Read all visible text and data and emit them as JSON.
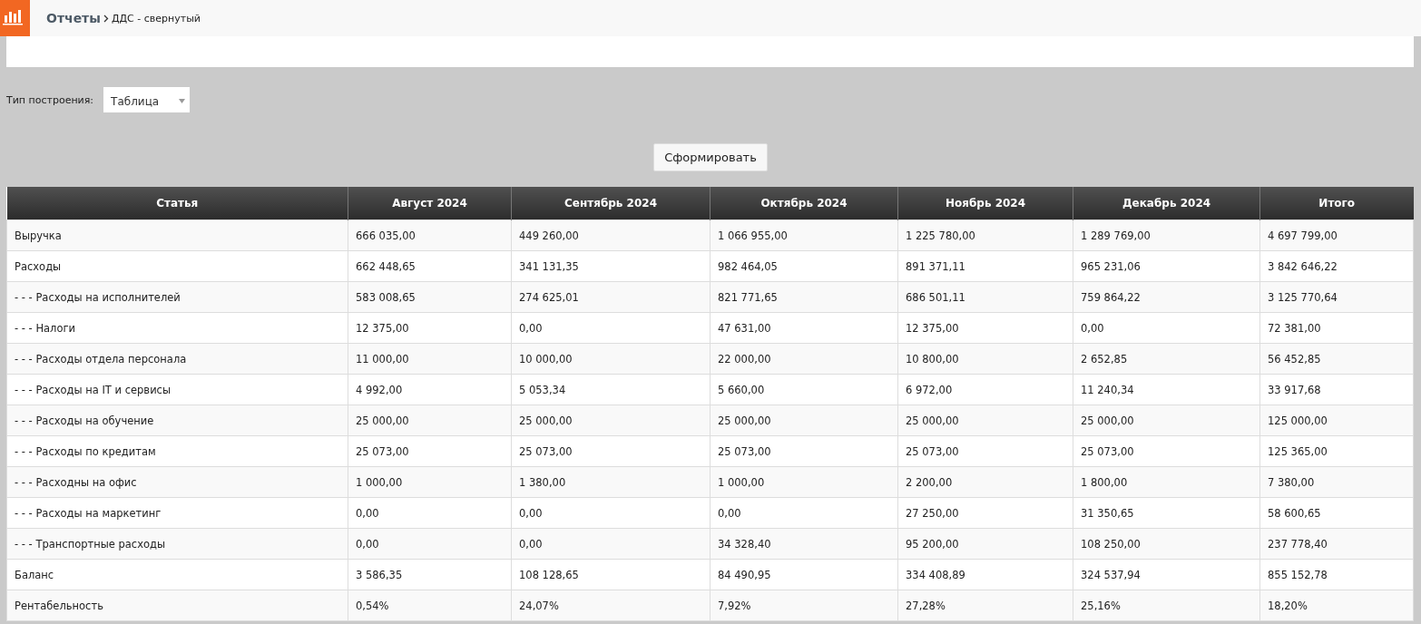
{
  "header": {
    "breadcrumb": [
      {
        "label": "Отчеты",
        "kind": "link"
      },
      {
        "label": "ДДС - свернутый",
        "kind": "current"
      }
    ]
  },
  "form": {
    "label": "Тип построения:",
    "select": {
      "value": "Таблица"
    },
    "button": "Сформировать"
  },
  "table": {
    "columns": [
      "Статья",
      "Август 2024",
      "Сентябрь 2024",
      "Октябрь 2024",
      "Ноябрь 2024",
      "Декабрь 2024",
      "Итого"
    ],
    "rows": [
      [
        "Выручка",
        "666 035,00",
        "449 260,00",
        "1 066 955,00",
        "1 225 780,00",
        "1 289 769,00",
        "4 697 799,00"
      ],
      [
        "Расходы",
        "662 448,65",
        "341 131,35",
        "982 464,05",
        "891 371,11",
        "965 231,06",
        "3 842 646,22"
      ],
      [
        "- - - Расходы на исполнителей",
        "583 008,65",
        "274 625,01",
        "821 771,65",
        "686 501,11",
        "759 864,22",
        "3 125 770,64"
      ],
      [
        "- - - Налоги",
        "12 375,00",
        "0,00",
        "47 631,00",
        "12 375,00",
        "0,00",
        "72 381,00"
      ],
      [
        "- - - Расходы отдела персонала",
        "11 000,00",
        "10 000,00",
        "22 000,00",
        "10 800,00",
        "2 652,85",
        "56 452,85"
      ],
      [
        "- - - Расходы на IT и сервисы",
        "4 992,00",
        "5 053,34",
        "5 660,00",
        "6 972,00",
        "11 240,34",
        "33 917,68"
      ],
      [
        "- - - Расходы на обучение",
        "25 000,00",
        "25 000,00",
        "25 000,00",
        "25 000,00",
        "25 000,00",
        "125 000,00"
      ],
      [
        "- - - Расходы по кредитам",
        "25 073,00",
        "25 073,00",
        "25 073,00",
        "25 073,00",
        "25 073,00",
        "125 365,00"
      ],
      [
        "- - - Расходны на офис",
        "1 000,00",
        "1 380,00",
        "1 000,00",
        "2 200,00",
        "1 800,00",
        "7 380,00"
      ],
      [
        "- - - Расходы на маркетинг",
        "0,00",
        "0,00",
        "0,00",
        "27 250,00",
        "31 350,65",
        "58 600,65"
      ],
      [
        "- - - Транспортные расходы",
        "0,00",
        "0,00",
        "34 328,40",
        "95 200,00",
        "108 250,00",
        "237 778,40"
      ],
      [
        "Баланс",
        "3 586,35",
        "108 128,65",
        "84 490,95",
        "334 408,89",
        "324 537,94",
        "855 152,78"
      ],
      [
        "Рентабельность",
        "0,54%",
        "24,07%",
        "7,92%",
        "27,28%",
        "25,16%",
        "18,20%"
      ]
    ]
  }
}
